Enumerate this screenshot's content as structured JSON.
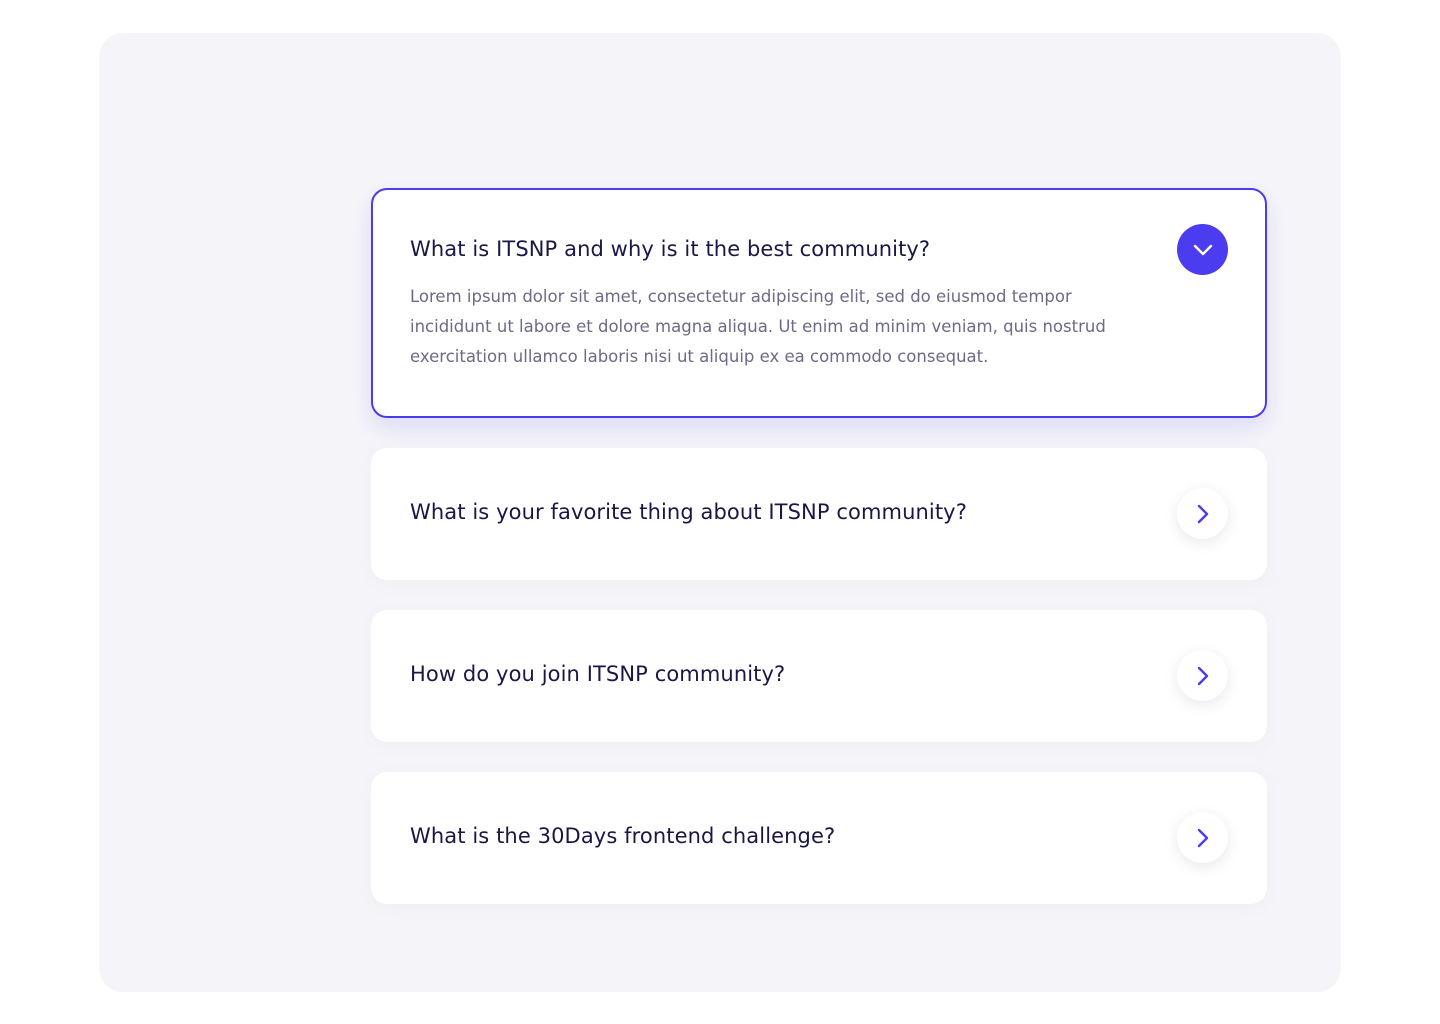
{
  "colors": {
    "accent": "#4b3cf0",
    "panel_background": "#f5f5f9",
    "card_background": "#ffffff",
    "question_text": "#1a1646",
    "answer_text": "#6d6a86"
  },
  "faq": {
    "items": [
      {
        "question": "What is ITSNP and why is it the best community?",
        "answer": "Lorem ipsum dolor sit amet, consectetur adipiscing elit, sed do eiusmod tempor incididunt ut labore et dolore magna aliqua. Ut enim ad minim veniam, quis nostrud exercitation ullamco laboris nisi ut aliquip ex ea commodo consequat.",
        "expanded": true,
        "icon": "chevron-down-icon"
      },
      {
        "question": "What is your favorite thing about ITSNP community?",
        "expanded": false,
        "icon": "chevron-right-icon"
      },
      {
        "question": "How do you join ITSNP community?",
        "expanded": false,
        "icon": "chevron-right-icon"
      },
      {
        "question": "What is the 30Days frontend challenge?",
        "expanded": false,
        "icon": "chevron-right-icon"
      }
    ]
  }
}
